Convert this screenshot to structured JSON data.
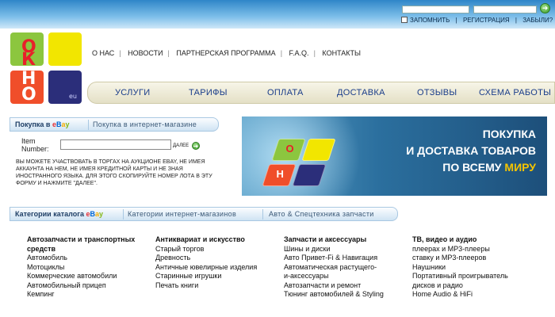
{
  "header": {
    "remember_label": "ЗАПОМНИТЬ",
    "register_label": "РЕГИСТРАЦИЯ",
    "forgot_label": "ЗАБЫЛИ?",
    "go_glyph": "➜"
  },
  "logo": {
    "letters": [
      "О",
      "К",
      "Н",
      "О"
    ],
    "suffix": "eu"
  },
  "menu": [
    "О НАС",
    "НОВОСТИ",
    "ПАРТНЕРСКАЯ ПРОГРАММА",
    "F.A.Q.",
    "КОНТАКТЫ"
  ],
  "nav": [
    "УСЛУГИ",
    "ТАРИФЫ",
    "ОПЛАТА",
    "ДОСТАВКА",
    "ОТЗЫВЫ",
    "СХЕМА РАБОТЫ"
  ],
  "purchase_tabs": {
    "first_prefix": "Покупка в",
    "ebay": [
      "e",
      "B",
      "a",
      "y"
    ],
    "second": "Покупка в интернет-магазине"
  },
  "item_form": {
    "label_line1": "Item",
    "label_line2": "Number:",
    "value": "",
    "next_label": "ДАЛЕЕ",
    "next_glyph": "➜",
    "help": "ВЫ МОЖЕТЕ УЧАСТВОВАТЬ В ТОРГАХ НА АУКЦИОНЕ EBAY, НЕ ИМЕЯ АККАУНТА НА НЕМ, НЕ ИМЕЯ КРЕДИТНОЙ КАРТЫ И НЕ ЗНАЯ ИНОСТРАННОГО ЯЗЫКА. ДЛЯ ЭТОГО СКОПИРУЙТЕ НОМЕР ЛОТА В ЭТУ ФОРМУ И НАЖМИТЕ \"ДАЛЕЕ\"."
  },
  "banner": {
    "line1": "ПОКУПКА",
    "line2": "И ДОСТАВКА ТОВАРОВ",
    "line3_prefix": "ПО ВСЕМУ",
    "line3_accent": "МИРУ"
  },
  "catalog_tabs": {
    "first_prefix": "Категории каталога",
    "ebay": [
      "e",
      "B",
      "a",
      "y"
    ],
    "second": "Категории интернет-магазинов",
    "third": "Авто & Спецтехника запчасти"
  },
  "categories": [
    {
      "head": [
        "Автозапчасти и транспортных",
        "средств"
      ],
      "items": [
        "Автомобиль",
        "Мотоциклы",
        "Коммерческие автомобили",
        "Автомобильный прицеп",
        "Кемпинг"
      ]
    },
    {
      "head": [
        "Антиквариат и искусство"
      ],
      "items": [
        "Старый торгов",
        "Древность",
        "Античные ювелирные изделия",
        "Старинные игрушки",
        "Печать книги"
      ]
    },
    {
      "head": [
        "Запчасти и аксессуары"
      ],
      "items": [
        "Шины и диски",
        "Авто Привет-Fi & Навигация",
        "Автоматическая растущего-",
        "и-аксессуары",
        "Автозапчасти и ремонт",
        "Тюнинг автомобилей & Styling"
      ]
    },
    {
      "head": [
        "ТВ, видео и аудио"
      ],
      "items": [
        "плеерах и MP3-плееры",
        "ставку и MP3-плееров",
        "Наушники",
        "Портативный проигрыватель",
        "дисков и радио",
        "Home Audio & HiFi"
      ]
    }
  ],
  "colors": {
    "tile_green": "#8cc63f",
    "tile_yellow": "#f2e600",
    "tile_red": "#e8202a",
    "tile_navy": "#2b2e7a",
    "nav_text": "#1a3d8a"
  },
  "icons": {
    "go": "arrow-right-icon",
    "checkbox": "checkbox-icon"
  }
}
